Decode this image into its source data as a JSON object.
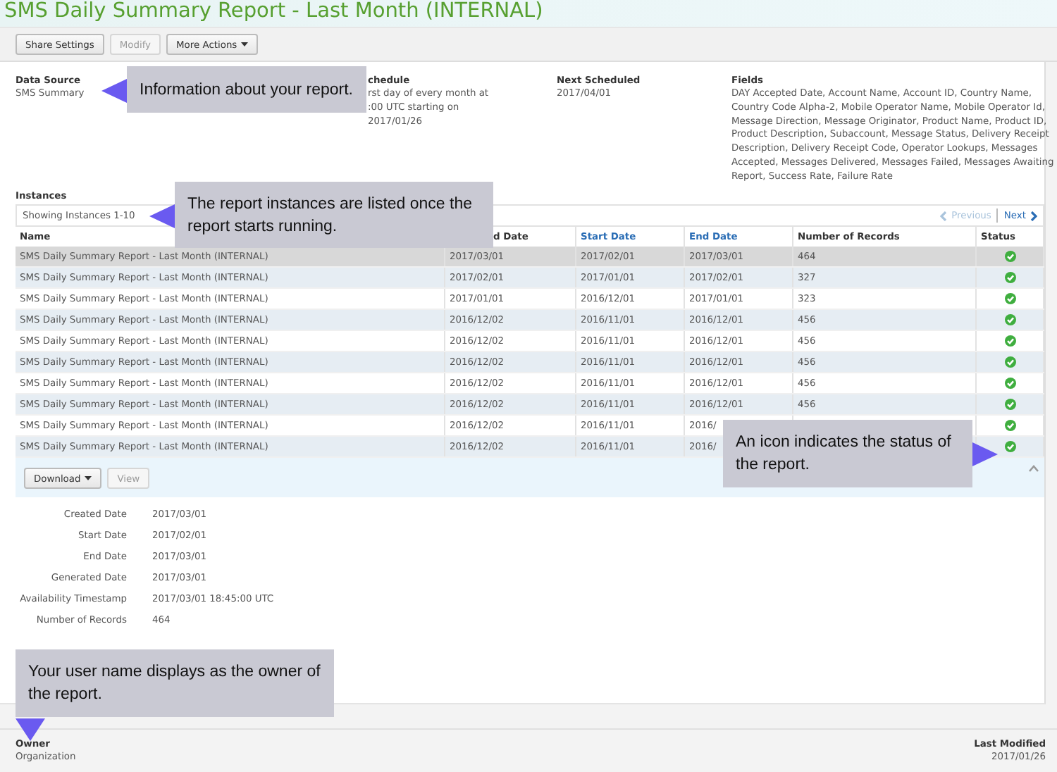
{
  "title": "SMS Daily Summary Report - Last Month (INTERNAL)",
  "toolbar": [
    {
      "label": "Share Settings",
      "disabled": false,
      "dropdown": false
    },
    {
      "label": "Modify",
      "disabled": true,
      "dropdown": false
    },
    {
      "label": "More Actions",
      "disabled": false,
      "dropdown": true
    }
  ],
  "info": [
    {
      "label": "Data Source",
      "lines": [
        "SMS Summary"
      ]
    },
    {
      "label": "chedule",
      "lines": [
        "rst day of every month at",
        ":00 UTC starting on",
        "2017/01/26"
      ]
    },
    {
      "label": "Next Scheduled",
      "lines": [
        "2017/04/01"
      ]
    },
    {
      "label": "Fields",
      "lines": [
        "DAY Accepted Date, Account Name, Account ID, Country Name, Country Code Alpha-2, Mobile Operator Name, Mobile Operator Id, Message Direction, Message Originator, Product Name, Product ID, Product Description, Subaccount, Message Status, Delivery Receipt Description, Delivery Receipt Code, Operator Lookups, Messages Accepted, Messages Delivered, Messages Failed, Messages Awaiting Report, Success Rate, Failure Rate"
      ]
    }
  ],
  "instances": {
    "label": "Instances",
    "showing": "Showing Instances 1-10",
    "pager": [
      {
        "label": "Previous",
        "disabled": true
      },
      {
        "label": "Next",
        "disabled": false
      }
    ],
    "columns": [
      {
        "label": "Name",
        "link": false
      },
      {
        "label": "d Date",
        "link": false
      },
      {
        "label": "Start Date",
        "link": true
      },
      {
        "label": "End Date",
        "link": true
      },
      {
        "label": "Number of Records",
        "link": false
      },
      {
        "label": "Status",
        "link": false
      }
    ],
    "rows": [
      {
        "selected": true,
        "cells": [
          "SMS Daily Summary Report - Last Month (INTERNAL)",
          "2017/03/01",
          "2017/02/01",
          "2017/03/01",
          "464"
        ]
      },
      {
        "selected": false,
        "cells": [
          "SMS Daily Summary Report - Last Month (INTERNAL)",
          "2017/02/01",
          "2017/01/01",
          "2017/02/01",
          "327"
        ]
      },
      {
        "selected": false,
        "cells": [
          "SMS Daily Summary Report - Last Month (INTERNAL)",
          "2017/01/01",
          "2016/12/01",
          "2017/01/01",
          "323"
        ]
      },
      {
        "selected": false,
        "cells": [
          "SMS Daily Summary Report - Last Month (INTERNAL)",
          "2016/12/02",
          "2016/11/01",
          "2016/12/01",
          "456"
        ]
      },
      {
        "selected": false,
        "cells": [
          "SMS Daily Summary Report - Last Month (INTERNAL)",
          "2016/12/02",
          "2016/11/01",
          "2016/12/01",
          "456"
        ]
      },
      {
        "selected": false,
        "cells": [
          "SMS Daily Summary Report - Last Month (INTERNAL)",
          "2016/12/02",
          "2016/11/01",
          "2016/12/01",
          "456"
        ]
      },
      {
        "selected": false,
        "cells": [
          "SMS Daily Summary Report - Last Month (INTERNAL)",
          "2016/12/02",
          "2016/11/01",
          "2016/12/01",
          "456"
        ]
      },
      {
        "selected": false,
        "cells": [
          "SMS Daily Summary Report - Last Month (INTERNAL)",
          "2016/12/02",
          "2016/11/01",
          "2016/12/01",
          "456"
        ]
      },
      {
        "selected": false,
        "cells": [
          "SMS Daily Summary Report - Last Month (INTERNAL)",
          "2016/12/02",
          "2016/11/01",
          "2016/"
        ]
      },
      {
        "selected": false,
        "cells": [
          "SMS Daily Summary Report - Last Month (INTERNAL)",
          "2016/12/02",
          "2016/11/01",
          "2016/"
        ]
      }
    ]
  },
  "detail": {
    "buttons": [
      {
        "label": "Download",
        "disabled": false,
        "dropdown": true
      },
      {
        "label": "View",
        "disabled": true,
        "dropdown": false
      }
    ],
    "fields": [
      {
        "label": "Created Date",
        "value": "2017/03/01"
      },
      {
        "label": "Start Date",
        "value": "2017/02/01"
      },
      {
        "label": "End Date",
        "value": "2017/03/01"
      },
      {
        "label": "Generated Date",
        "value": "2017/03/01"
      },
      {
        "label": "Availability Timestamp",
        "value": "2017/03/01 18:45:00 UTC"
      },
      {
        "label": "Number of Records",
        "value": "464"
      }
    ]
  },
  "footer": [
    {
      "label": "Owner",
      "value": "Organization"
    },
    {
      "label": "Last Modified",
      "value": "2017/01/26"
    }
  ],
  "callouts": [
    {
      "text": "Information about your report.",
      "kind": "left"
    },
    {
      "text": "The report instances are listed once the report starts running.",
      "kind": "left"
    },
    {
      "text": "An icon indicates the status of the report.",
      "kind": "right"
    },
    {
      "text": "Your user name displays as the owner of the report.",
      "kind": "down"
    }
  ]
}
